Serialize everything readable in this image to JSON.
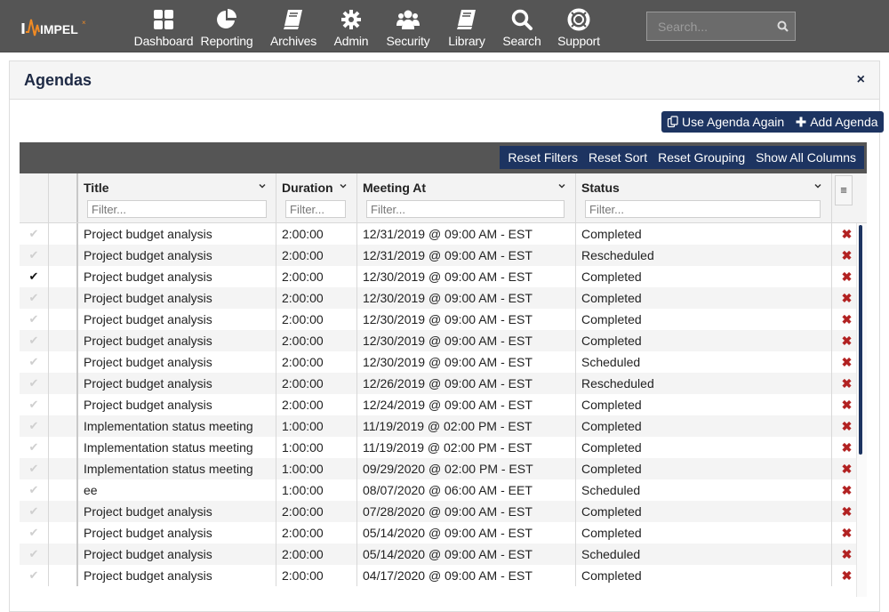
{
  "app": {
    "brand": "IMPEL",
    "nav": [
      {
        "label": "Dashboard",
        "icon": "dashboard-icon"
      },
      {
        "label": "Reporting",
        "icon": "pie-chart-icon"
      },
      {
        "label": "Archives",
        "icon": "book-icon"
      },
      {
        "label": "Admin",
        "icon": "gear-icon"
      },
      {
        "label": "Security",
        "icon": "users-icon"
      },
      {
        "label": "Library",
        "icon": "book-icon"
      },
      {
        "label": "Search",
        "icon": "search-icon"
      },
      {
        "label": "Support",
        "icon": "life-ring-icon"
      }
    ],
    "search": {
      "placeholder": "Search...",
      "value": ""
    }
  },
  "panel": {
    "title": "Agendas",
    "close_label": "×",
    "actions": {
      "use_again": "Use Agenda Again",
      "add": "Add Agenda"
    }
  },
  "grid": {
    "toolbar": [
      "Reset Filters",
      "Reset Sort",
      "Reset Grouping",
      "Show All Columns"
    ],
    "columns": [
      {
        "key": "title",
        "label": "Title",
        "filter_placeholder": "Filter..."
      },
      {
        "key": "duration",
        "label": "Duration",
        "filter_placeholder": "Filter..."
      },
      {
        "key": "meeting_at",
        "label": "Meeting At",
        "filter_placeholder": "Filter..."
      },
      {
        "key": "status",
        "label": "Status",
        "filter_placeholder": "Filter..."
      }
    ],
    "column_menu_label": "≡",
    "delete_label": "✖",
    "rows": [
      {
        "selected": false,
        "title": "Project budget analysis",
        "duration": "2:00:00",
        "meeting_at": "12/31/2019 @ 09:00 AM - EST",
        "status": "Completed"
      },
      {
        "selected": false,
        "title": "Project budget analysis",
        "duration": "2:00:00",
        "meeting_at": "12/31/2019 @ 09:00 AM - EST",
        "status": "Rescheduled"
      },
      {
        "selected": true,
        "title": "Project budget analysis",
        "duration": "2:00:00",
        "meeting_at": "12/30/2019 @ 09:00 AM - EST",
        "status": "Completed"
      },
      {
        "selected": false,
        "title": "Project budget analysis",
        "duration": "2:00:00",
        "meeting_at": "12/30/2019 @ 09:00 AM - EST",
        "status": "Completed"
      },
      {
        "selected": false,
        "title": "Project budget analysis",
        "duration": "2:00:00",
        "meeting_at": "12/30/2019 @ 09:00 AM - EST",
        "status": "Completed"
      },
      {
        "selected": false,
        "title": "Project budget analysis",
        "duration": "2:00:00",
        "meeting_at": "12/30/2019 @ 09:00 AM - EST",
        "status": "Completed"
      },
      {
        "selected": false,
        "title": "Project budget analysis",
        "duration": "2:00:00",
        "meeting_at": "12/30/2019 @ 09:00 AM - EST",
        "status": "Scheduled"
      },
      {
        "selected": false,
        "title": "Project budget analysis",
        "duration": "2:00:00",
        "meeting_at": "12/26/2019 @ 09:00 AM - EST",
        "status": "Rescheduled"
      },
      {
        "selected": false,
        "title": "Project budget analysis",
        "duration": "2:00:00",
        "meeting_at": "12/24/2019 @ 09:00 AM - EST",
        "status": "Completed"
      },
      {
        "selected": false,
        "title": "Implementation status meeting",
        "duration": "1:00:00",
        "meeting_at": "11/19/2019 @ 02:00 PM - EST",
        "status": "Completed"
      },
      {
        "selected": false,
        "title": "Implementation status meeting",
        "duration": "1:00:00",
        "meeting_at": "11/19/2019 @ 02:00 PM - EST",
        "status": "Completed"
      },
      {
        "selected": false,
        "title": "Implementation status meeting",
        "duration": "1:00:00",
        "meeting_at": "09/29/2020 @ 02:00 PM - EST",
        "status": "Completed"
      },
      {
        "selected": false,
        "title": "ee",
        "duration": "1:00:00",
        "meeting_at": "08/07/2020 @ 06:00 AM - EET",
        "status": "Scheduled"
      },
      {
        "selected": false,
        "title": "Project budget analysis",
        "duration": "2:00:00",
        "meeting_at": "07/28/2020 @ 09:00 AM - EST",
        "status": "Completed"
      },
      {
        "selected": false,
        "title": "Project budget analysis",
        "duration": "2:00:00",
        "meeting_at": "05/14/2020 @ 09:00 AM - EST",
        "status": "Completed"
      },
      {
        "selected": false,
        "title": "Project budget analysis",
        "duration": "2:00:00",
        "meeting_at": "05/14/2020 @ 09:00 AM - EST",
        "status": "Scheduled"
      },
      {
        "selected": false,
        "title": "Project budget analysis",
        "duration": "2:00:00",
        "meeting_at": "04/17/2020 @ 09:00 AM - EST",
        "status": "Completed"
      }
    ]
  },
  "colors": {
    "nav_bg": "#555555",
    "accent_navy": "#1d3461",
    "delete_red": "#b22222",
    "logo_orange": "#f08a24"
  }
}
